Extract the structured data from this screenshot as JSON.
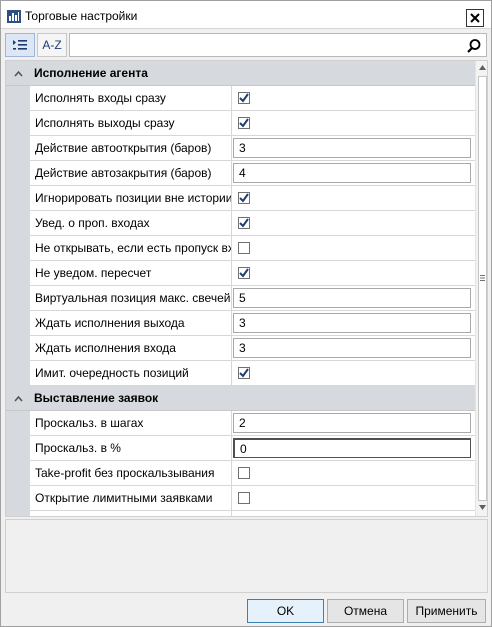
{
  "window": {
    "title": "Торговые настройки"
  },
  "toolbar": {
    "az_label": "A-Z",
    "search_value": ""
  },
  "categories": [
    {
      "label": "Исполнение агента",
      "rows": [
        {
          "name": "Исполнять входы сразу",
          "type": "check",
          "checked": true
        },
        {
          "name": "Исполнять выходы сразу",
          "type": "check",
          "checked": true
        },
        {
          "name": "Действие автооткрытия (баров)",
          "type": "text",
          "value": "3"
        },
        {
          "name": "Действие автозакрытия (баров)",
          "type": "text",
          "value": "4"
        },
        {
          "name": "Игнорировать позиции вне истории",
          "type": "check",
          "checked": true
        },
        {
          "name": "Увед. о проп. входах",
          "type": "check",
          "checked": true
        },
        {
          "name": "Не открывать, если есть пропуск вход",
          "type": "check",
          "checked": false
        },
        {
          "name": "Не уведом. пересчет",
          "type": "check",
          "checked": true
        },
        {
          "name": "Виртуальная позиция макс. свечей",
          "type": "text",
          "value": "5"
        },
        {
          "name": "Ждать исполнения выхода",
          "type": "text",
          "value": "3"
        },
        {
          "name": "Ждать исполнения входа",
          "type": "text",
          "value": "3"
        },
        {
          "name": "Имит. очередность позиций",
          "type": "check",
          "checked": true
        }
      ]
    },
    {
      "label": "Выставление заявок",
      "rows": [
        {
          "name": "Проскальз. в шагах",
          "type": "text",
          "value": "2"
        },
        {
          "name": "Проскальз. в %",
          "type": "text",
          "value": "0",
          "active": true
        },
        {
          "name": "Take-profit без проскальзывания",
          "type": "check",
          "checked": false
        },
        {
          "name": "Открытие лимитными заявками",
          "type": "check",
          "checked": false
        },
        {
          "name": "",
          "type": "check",
          "checked": false
        }
      ]
    }
  ],
  "buttons": {
    "ok": "OK",
    "cancel": "Отмена",
    "apply": "Применить"
  },
  "colors": {
    "category_bg": "#d6d9dd",
    "check": "#1f3f73",
    "accent": "#3c7fb1"
  }
}
